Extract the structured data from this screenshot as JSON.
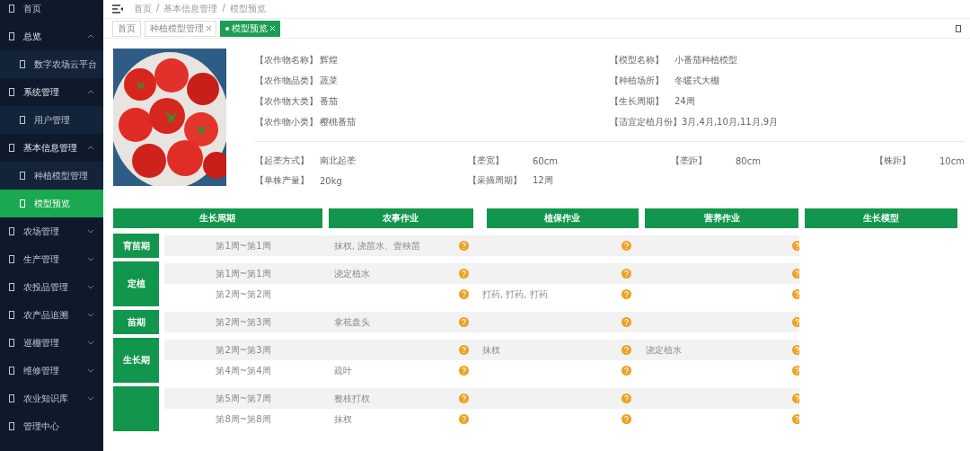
{
  "sidebar": {
    "items": [
      {
        "label": "首页",
        "expanded": false,
        "has_children": false
      },
      {
        "label": "总览",
        "expanded": true,
        "has_children": true,
        "children": [
          {
            "label": "数字农场云平台",
            "selected": false
          }
        ]
      },
      {
        "label": "系统管理",
        "expanded": true,
        "has_children": true,
        "children": [
          {
            "label": "用户管理",
            "selected": false
          }
        ]
      },
      {
        "label": "基本信息管理",
        "expanded": true,
        "has_children": true,
        "children": [
          {
            "label": "种植模型管理",
            "selected": false
          },
          {
            "label": "模型预览",
            "selected": true
          }
        ]
      },
      {
        "label": "农场管理",
        "expanded": false,
        "has_children": true
      },
      {
        "label": "生产管理",
        "expanded": false,
        "has_children": true
      },
      {
        "label": "农投品管理",
        "expanded": false,
        "has_children": true
      },
      {
        "label": "农产品追溯",
        "expanded": false,
        "has_children": true
      },
      {
        "label": "巡棚管理",
        "expanded": false,
        "has_children": true
      },
      {
        "label": "维修管理",
        "expanded": false,
        "has_children": true
      },
      {
        "label": "农业知识库",
        "expanded": false,
        "has_children": true
      },
      {
        "label": "管理中心",
        "expanded": false,
        "has_children": false
      }
    ]
  },
  "breadcrumb": [
    "首页",
    "基本信息管理",
    "模型预览"
  ],
  "breadcrumb_separator": "/",
  "tabs": [
    {
      "label": "首页",
      "closable": false,
      "selected": false
    },
    {
      "label": "种植模型管理",
      "closable": true,
      "selected": false
    },
    {
      "label": "模型预览",
      "closable": true,
      "selected": true
    }
  ],
  "info": {
    "left": [
      {
        "label": "【农作物名称】",
        "value": "辉煌"
      },
      {
        "label": "【农作物品类】",
        "value": "蔬菜"
      },
      {
        "label": "【农作物大类】",
        "value": "番茄"
      },
      {
        "label": "【农作物小类】",
        "value": "樱桃番茄"
      }
    ],
    "right": [
      {
        "label": "【模型名称】",
        "value": "小番茄种植模型"
      },
      {
        "label": "【种植场所】",
        "value": "冬暖式大棚"
      },
      {
        "label": "【生长周期】",
        "value": "24周"
      },
      {
        "label": "【适宜定植月份】",
        "value": "3月,4月,10月,11月,9月"
      }
    ],
    "details": [
      {
        "label": "【起垄方式】",
        "value": "南北起垄"
      },
      {
        "label": "【垄宽】",
        "value": "60cm"
      },
      {
        "label": "【垄距】",
        "value": "80cm"
      },
      {
        "label": "【株距】",
        "value": "10cm"
      },
      {
        "label": "【单株产量】",
        "value": "20kg"
      },
      {
        "label": "【采摘周期】",
        "value": "12周"
      }
    ]
  },
  "table": {
    "columns": [
      "生长周期",
      "农事作业",
      "植保作业",
      "营养作业",
      "生长模型"
    ],
    "stages": [
      {
        "name": "育苗期",
        "rows": [
          {
            "weeks": "第1周~第1周",
            "farming": "抹杈, 浇苗水、壹秧苗"
          }
        ]
      },
      {
        "name": "定植",
        "rows": [
          {
            "weeks": "第1周~第1周",
            "farming": "浇定植水"
          },
          {
            "weeks": "第2周~第2周",
            "protection": "打药, 打药, 打药"
          }
        ]
      },
      {
        "name": "苗期",
        "rows": [
          {
            "weeks": "第2周~第3周",
            "farming": "拿苞盘头"
          }
        ]
      },
      {
        "name": "生长期",
        "rows": [
          {
            "weeks": "第2周~第3周",
            "protection": "抹杈",
            "nutrition": "浇定植水"
          },
          {
            "weeks": "第4周~第4周",
            "farming": "疏叶"
          }
        ]
      },
      {
        "rows": [
          {
            "weeks": "第5周~第7周",
            "farming": "整枝打杈"
          },
          {
            "weeks": "第8周~第8周",
            "farming": "抹杈"
          }
        ]
      }
    ]
  }
}
